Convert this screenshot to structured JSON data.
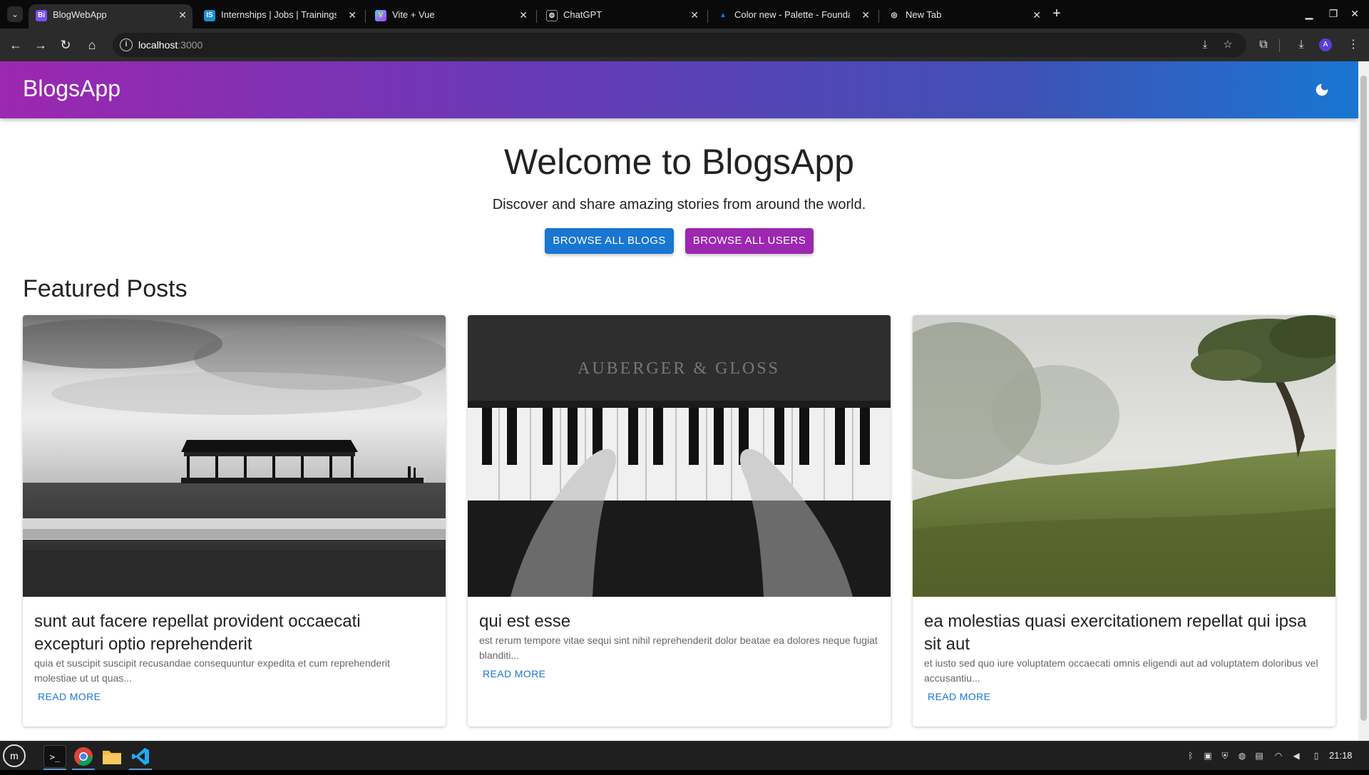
{
  "browser": {
    "tabs": [
      {
        "title": "BlogWebApp",
        "favicon": "Bi",
        "favicon_color": "#7c4dff",
        "active": true
      },
      {
        "title": "Internships | Jobs | Trainings",
        "favicon": "IS",
        "favicon_color": "#1a8fd9",
        "active": false
      },
      {
        "title": "Vite + Vue",
        "favicon": "V",
        "favicon_color": "#a855f7",
        "active": false
      },
      {
        "title": "ChatGPT",
        "favicon": "⚙",
        "favicon_color": "#ffffff",
        "active": false
      },
      {
        "title": "Color new - Palette - Founda",
        "favicon": "▲",
        "favicon_color": "#1a73e8",
        "active": false
      },
      {
        "title": "New Tab",
        "favicon": "◎",
        "favicon_color": "#ffffff",
        "active": false
      }
    ],
    "url_host": "localhost",
    "url_port": ":3000",
    "profile_initial": "A"
  },
  "app": {
    "brand": "BlogsApp",
    "hero_title": "Welcome to BlogsApp",
    "hero_subtitle": "Discover and share amazing stories from around the world.",
    "browse_blogs_label": "BROWSE ALL BLOGS",
    "browse_users_label": "BROWSE ALL USERS",
    "featured_title": "Featured Posts",
    "read_more_label": "READ MORE",
    "colors": {
      "primary": "#1976d2",
      "secondary": "#9c27b0"
    }
  },
  "posts": [
    {
      "title": "sunt aut facere repellat provident occaecati excepturi optio reprehenderit",
      "excerpt": "quia et suscipit suscipit recusandae consequuntur expedita et cum reprehenderit molestiae ut ut quas...",
      "read_more": "READ MORE"
    },
    {
      "title": "qui est esse",
      "excerpt": "est rerum tempore vitae sequi sint nihil reprehenderit dolor beatae ea dolores neque fugiat blanditi...",
      "read_more": "READ MORE"
    },
    {
      "title": "ea molestias quasi exercitationem repellat qui ipsa sit aut",
      "excerpt": "et iusto sed quo iure voluptatem occaecati omnis eligendi aut ad voluptatem doloribus vel accusantiu...",
      "read_more": "READ MORE"
    }
  ],
  "taskbar": {
    "clock": "21:18"
  }
}
